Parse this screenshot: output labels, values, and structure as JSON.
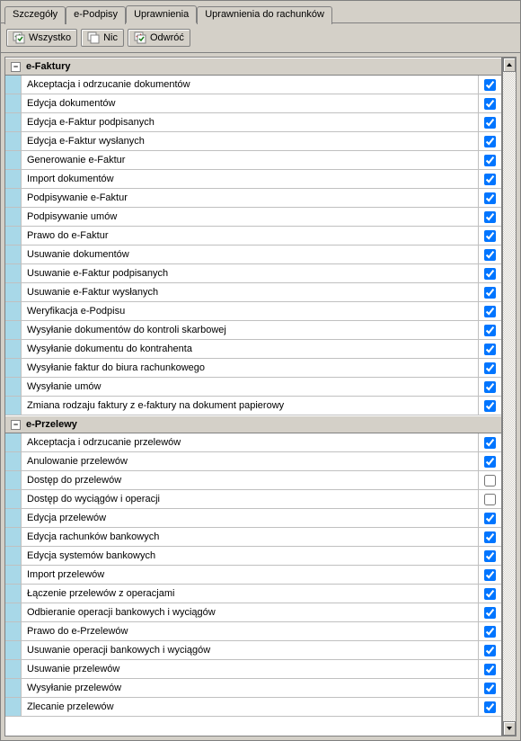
{
  "tabs": [
    {
      "label": "Szczegóły",
      "active": false
    },
    {
      "label": "e-Podpisy",
      "active": false
    },
    {
      "label": "Uprawnienia",
      "active": true
    },
    {
      "label": "Uprawnienia do rachunków",
      "active": false
    }
  ],
  "toolbar": {
    "all": "Wszystko",
    "none": "Nic",
    "invert": "Odwróć"
  },
  "groups": [
    {
      "title": "e-Faktury",
      "items": [
        {
          "label": "Akceptacja i odrzucanie dokumentów",
          "checked": true
        },
        {
          "label": "Edycja dokumentów",
          "checked": true
        },
        {
          "label": "Edycja e-Faktur podpisanych",
          "checked": true
        },
        {
          "label": "Edycja e-Faktur wysłanych",
          "checked": true
        },
        {
          "label": "Generowanie e-Faktur",
          "checked": true
        },
        {
          "label": "Import dokumentów",
          "checked": true
        },
        {
          "label": "Podpisywanie e-Faktur",
          "checked": true
        },
        {
          "label": "Podpisywanie umów",
          "checked": true
        },
        {
          "label": "Prawo do e-Faktur",
          "checked": true
        },
        {
          "label": "Usuwanie dokumentów",
          "checked": true
        },
        {
          "label": "Usuwanie e-Faktur podpisanych",
          "checked": true
        },
        {
          "label": "Usuwanie e-Faktur wysłanych",
          "checked": true
        },
        {
          "label": "Weryfikacja e-Podpisu",
          "checked": true
        },
        {
          "label": "Wysyłanie dokumentów do kontroli skarbowej",
          "checked": true
        },
        {
          "label": "Wysyłanie dokumentu do kontrahenta",
          "checked": true
        },
        {
          "label": "Wysyłanie faktur do biura rachunkowego",
          "checked": true
        },
        {
          "label": "Wysyłanie umów",
          "checked": true
        },
        {
          "label": "Zmiana rodzaju faktury z e-faktury na dokument papierowy",
          "checked": true
        }
      ]
    },
    {
      "title": "e-Przelewy",
      "items": [
        {
          "label": "Akceptacja i odrzucanie przelewów",
          "checked": true
        },
        {
          "label": "Anulowanie przelewów",
          "checked": true
        },
        {
          "label": "Dostęp do przelewów",
          "checked": false
        },
        {
          "label": "Dostęp do wyciągów i operacji",
          "checked": false
        },
        {
          "label": "Edycja przelewów",
          "checked": true
        },
        {
          "label": "Edycja rachunków bankowych",
          "checked": true
        },
        {
          "label": "Edycja systemów bankowych",
          "checked": true
        },
        {
          "label": "Import przelewów",
          "checked": true
        },
        {
          "label": "Łączenie przelewów z operacjami",
          "checked": true
        },
        {
          "label": "Odbieranie operacji bankowych i wyciągów",
          "checked": true
        },
        {
          "label": "Prawo do e-Przelewów",
          "checked": true
        },
        {
          "label": "Usuwanie operacji bankowych i wyciągów",
          "checked": true
        },
        {
          "label": "Usuwanie przelewów",
          "checked": true
        },
        {
          "label": "Wysyłanie przelewów",
          "checked": true
        },
        {
          "label": "Zlecanie przelewów",
          "checked": true
        }
      ]
    }
  ]
}
